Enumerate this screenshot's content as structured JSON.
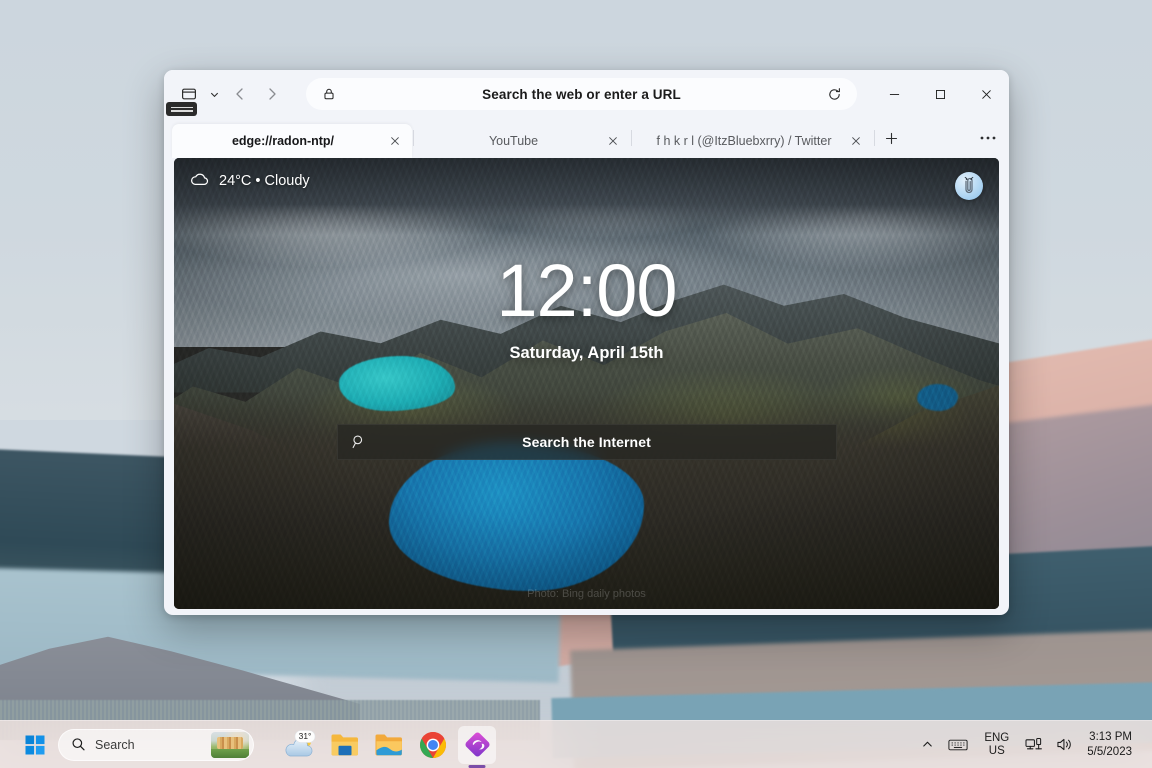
{
  "desktop": {
    "wallpaper_name": "windows-11-dunes-wallpaper"
  },
  "browser": {
    "window_title": "Microsoft Edge",
    "toolbar": {
      "tab_actions_label": "Tab actions menu",
      "tab_actions_chevron": "chevron-down",
      "back_label": "Back",
      "forward_label": "Forward",
      "address_placeholder": "Search the web or enter a URL",
      "address_value": "",
      "lock_icon": "lock-icon",
      "reload_label": "Refresh",
      "minimize_label": "Minimize",
      "maximize_label": "Maximize",
      "close_label": "Close"
    },
    "tabs": [
      {
        "label": "edge://radon-ntp/",
        "active": true,
        "close_label": "Close tab"
      },
      {
        "label": "YouTube",
        "active": false,
        "close_label": "Close tab"
      },
      {
        "label": "f h k r l (@ItzBluebxrry) / Twitter",
        "active": false,
        "close_label": "Close tab"
      }
    ],
    "new_tab_label": "+",
    "tab_more_label": "···"
  },
  "newtab": {
    "weather": {
      "icon": "cloud-icon",
      "text": "24°C • Cloudy",
      "temperature": "24°C",
      "condition": "Cloudy"
    },
    "avatar_label": "clippy-avatar",
    "clock": {
      "time": "12:00",
      "date": "Saturday, April 15th"
    },
    "search": {
      "icon": "search-icon",
      "placeholder": "Search the Internet"
    },
    "photo_credit": "Photo: Bing daily photos"
  },
  "taskbar": {
    "start_label": "Start",
    "search": {
      "icon": "search-icon",
      "placeholder": "Search",
      "thumbnail_label": "search-highlight-thumbnail"
    },
    "apps": [
      {
        "name": "weather-widget",
        "label": "31°",
        "active": false
      },
      {
        "name": "file-explorer",
        "label": "File Explorer",
        "active": false
      },
      {
        "name": "file-explorer-alt",
        "label": "File Explorer",
        "active": false
      },
      {
        "name": "google-chrome",
        "label": "Google Chrome",
        "active": false
      },
      {
        "name": "edge-canary",
        "label": "Microsoft Edge Canary",
        "active": true
      }
    ],
    "tray": {
      "show_hidden_label": "Show hidden icons",
      "keyboard_label": "Touch keyboard",
      "language_line1": "ENG",
      "language_line2": "US",
      "network_label": "Network",
      "volume_label": "Volume",
      "time": "3:13 PM",
      "date": "5/5/2023"
    }
  },
  "colors": {
    "accent": "#0067c0",
    "taskbar_bg": "#f1e4e0",
    "edge_canary_accent": "#7b4ea8"
  }
}
